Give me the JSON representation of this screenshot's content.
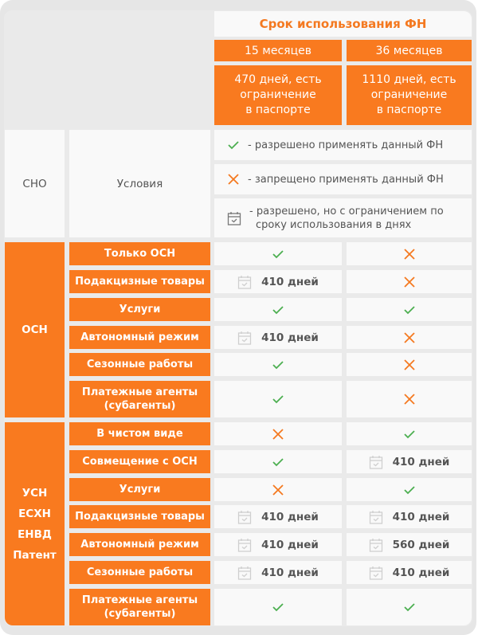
{
  "header": {
    "title": "Срок использования ФН",
    "columns": [
      {
        "period": "15 месяцев",
        "description": "470 дней, есть ограничение в паспорте",
        "description_lines": [
          "470 дней, есть",
          "ограничение",
          "в паспорте"
        ]
      },
      {
        "period": "36 месяцев",
        "description": "1110 дней, есть ограничение в паспорте",
        "description_lines": [
          "1110 дней, есть",
          "ограничение",
          "в паспорте"
        ]
      }
    ]
  },
  "labels": {
    "sno": "СНО",
    "conditions": "Условия"
  },
  "legend": [
    {
      "icon": "check-icon",
      "text": "- разрешено применять данный ФН"
    },
    {
      "icon": "cross-icon",
      "text": "- запрещено применять данный ФН"
    },
    {
      "icon": "calendar-check-icon",
      "text_lines": [
        "- разрешено, но с ограничением по",
        "сроку использования в днях"
      ]
    }
  ],
  "colors": {
    "accent": "#f97a1f",
    "allowed": "#4caf50",
    "forbidden": "#f47920",
    "limited": "#cfcfcf"
  },
  "groups": [
    {
      "sno_lines": [
        "ОСН"
      ],
      "rows": [
        {
          "condition_lines": [
            "Только ОСН"
          ],
          "values": [
            {
              "status": "allowed"
            },
            {
              "status": "forbidden"
            }
          ]
        },
        {
          "condition_lines": [
            "Подакцизные товары"
          ],
          "values": [
            {
              "status": "limited",
              "text": "410 дней"
            },
            {
              "status": "forbidden"
            }
          ]
        },
        {
          "condition_lines": [
            "Услуги"
          ],
          "values": [
            {
              "status": "allowed"
            },
            {
              "status": "allowed"
            }
          ]
        },
        {
          "condition_lines": [
            "Автономный режим"
          ],
          "values": [
            {
              "status": "limited",
              "text": "410 дней"
            },
            {
              "status": "forbidden"
            }
          ]
        },
        {
          "condition_lines": [
            "Сезонные работы"
          ],
          "values": [
            {
              "status": "allowed"
            },
            {
              "status": "forbidden"
            }
          ]
        },
        {
          "condition_lines": [
            "Платежные агенты",
            "(субагенты)"
          ],
          "values": [
            {
              "status": "allowed"
            },
            {
              "status": "forbidden"
            }
          ]
        }
      ]
    },
    {
      "sno_lines": [
        "УСН",
        "ЕСХН",
        "ЕНВД",
        "Патент"
      ],
      "rows": [
        {
          "condition_lines": [
            "В чистом виде"
          ],
          "values": [
            {
              "status": "forbidden"
            },
            {
              "status": "allowed"
            }
          ]
        },
        {
          "condition_lines": [
            "Совмещение с ОСН"
          ],
          "values": [
            {
              "status": "allowed"
            },
            {
              "status": "limited",
              "text": "410 дней"
            }
          ]
        },
        {
          "condition_lines": [
            "Услуги"
          ],
          "values": [
            {
              "status": "forbidden"
            },
            {
              "status": "allowed"
            }
          ]
        },
        {
          "condition_lines": [
            "Подакцизные товары"
          ],
          "values": [
            {
              "status": "limited",
              "text": "410 дней"
            },
            {
              "status": "limited",
              "text": "410 дней"
            }
          ]
        },
        {
          "condition_lines": [
            "Автономный режим"
          ],
          "values": [
            {
              "status": "limited",
              "text": "410 дней"
            },
            {
              "status": "limited",
              "text": "560 дней"
            }
          ]
        },
        {
          "condition_lines": [
            "Сезонные работы"
          ],
          "values": [
            {
              "status": "limited",
              "text": "410 дней"
            },
            {
              "status": "limited",
              "text": "410 дней"
            }
          ]
        },
        {
          "condition_lines": [
            "Платежные агенты",
            "(субагенты)"
          ],
          "values": [
            {
              "status": "allowed"
            },
            {
              "status": "allowed"
            }
          ]
        }
      ]
    }
  ]
}
